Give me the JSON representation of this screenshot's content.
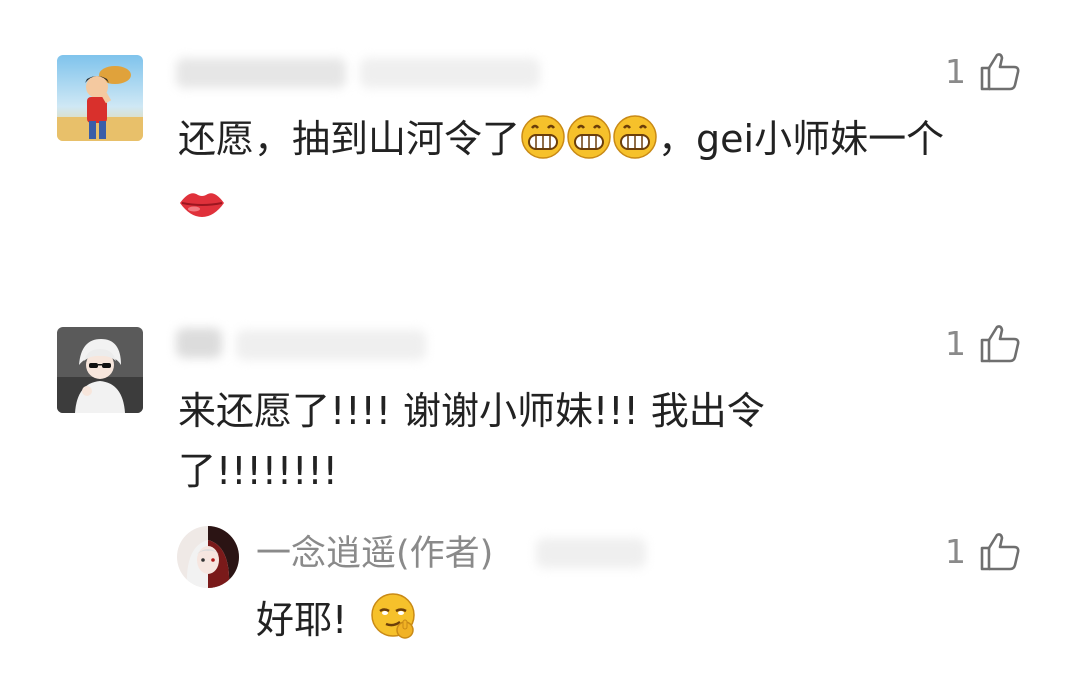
{
  "comments": [
    {
      "text_line1": "还愿，抽到山河令了",
      "text_line1_tail": "，gei小师妹一个",
      "emoji_grin": "grinning-face-icon",
      "emoji_lips": "lips-icon",
      "likes": "1"
    },
    {
      "text_line1": "来还愿了!!!! 谢谢小师妹!!! 我出令",
      "text_line2": "了!!!!!!!!",
      "likes": "1",
      "reply": {
        "author": "一念逍遥(作者)",
        "text": "好耶!",
        "emoji": "smirking-face-icon",
        "likes": "1"
      }
    }
  ],
  "icons": {
    "like": "thumbs-up-icon"
  },
  "colors": {
    "text": "#222222",
    "meta": "#8a8a8a",
    "lips": "#e0313b",
    "emoji": "#f6c12b"
  }
}
